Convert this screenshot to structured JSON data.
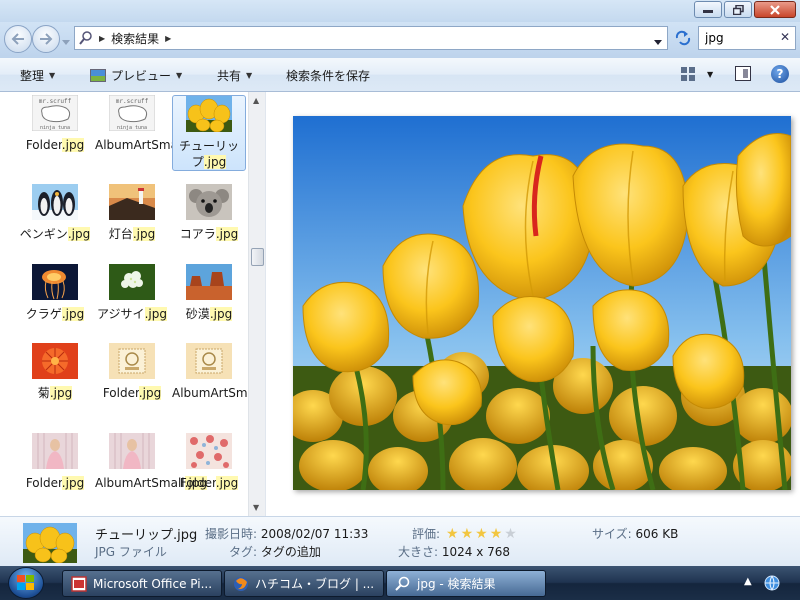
{
  "window": {
    "caption_buttons": [
      "minimize",
      "restore",
      "close"
    ]
  },
  "address": {
    "crumb": "検索結果",
    "search_value": "jpg"
  },
  "toolbar": {
    "organize": "整理",
    "preview": "プレビュー",
    "share": "共有",
    "save_search": "検索条件を保存"
  },
  "files": [
    {
      "name": "Folder",
      "ext": ".jpg",
      "thumb": "mrscruff"
    },
    {
      "name": "AlbumArtSmall",
      "ext": ".jpg",
      "thumb": "mrscruff"
    },
    {
      "name": "チューリップ",
      "ext": ".jpg",
      "thumb": "tulip",
      "selected": true
    },
    {
      "name": "ペンギン",
      "ext": ".jpg",
      "thumb": "penguins"
    },
    {
      "name": "灯台",
      "ext": ".jpg",
      "thumb": "lighthouse"
    },
    {
      "name": "コアラ",
      "ext": ".jpg",
      "thumb": "koala"
    },
    {
      "name": "クラゲ",
      "ext": ".jpg",
      "thumb": "jellyfish"
    },
    {
      "name": "アジサイ",
      "ext": ".jpg",
      "thumb": "hydrangea"
    },
    {
      "name": "砂漠",
      "ext": ".jpg",
      "thumb": "desert"
    },
    {
      "name": "菊",
      "ext": ".jpg",
      "thumb": "chrysanthemum"
    },
    {
      "name": "Folder",
      "ext": ".jpg",
      "thumb": "stamp"
    },
    {
      "name": "AlbumArtSmall",
      "ext": ".jpg",
      "thumb": "stamp"
    },
    {
      "name": "Folder",
      "ext": ".jpg",
      "thumb": "pinkgirl"
    },
    {
      "name": "AlbumArtSmall",
      "ext": ".jpg",
      "thumb": "pinkgirl"
    },
    {
      "name": "Folder",
      "ext": ".jpg",
      "thumb": "floral"
    }
  ],
  "details": {
    "filename": "チューリップ.jpg",
    "filetype": "JPG ファイル",
    "date_label": "撮影日時:",
    "date_value": "2008/02/07 11:33",
    "tags_label": "タグ:",
    "tags_value": "タグの追加",
    "rating_label": "評価:",
    "rating_value": 4,
    "dims_label": "大きさ:",
    "dims_value": "1024 x 768",
    "size_label": "サイズ:",
    "size_value": "606 KB"
  },
  "taskbar": {
    "tasks": [
      {
        "label": "Microsoft Office Pi..."
      },
      {
        "label": "ハチコム・ブログ | ..."
      },
      {
        "label": "jpg - 検索結果"
      }
    ]
  },
  "colors": {
    "ext_highlight": "#fff9b0",
    "selection": "#cde4fc",
    "star_on": "#f2c640"
  }
}
